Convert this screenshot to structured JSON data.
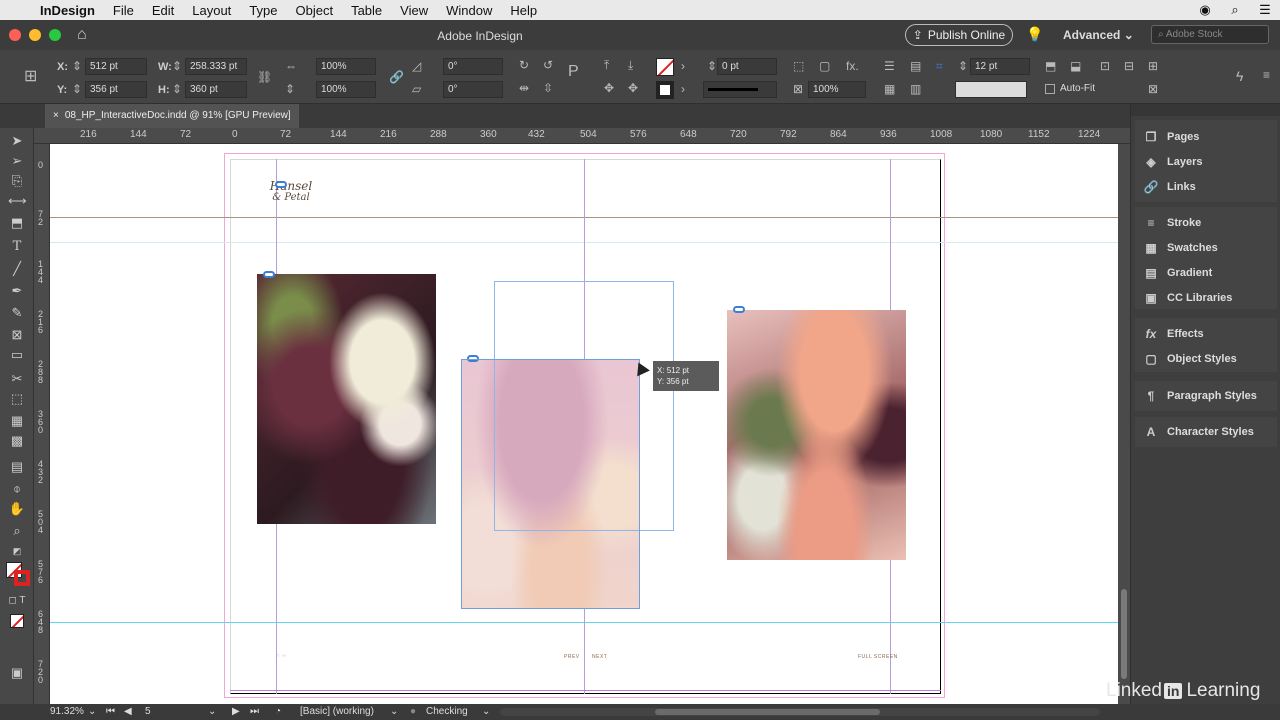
{
  "menubar": {
    "app": "InDesign",
    "items": [
      "File",
      "Edit",
      "Layout",
      "Type",
      "Object",
      "Table",
      "View",
      "Window",
      "Help"
    ]
  },
  "appbar": {
    "title": "Adobe InDesign",
    "publish": "Publish Online",
    "workspace": "Advanced",
    "stock_placeholder": "Adobe Stock"
  },
  "control": {
    "x_label": "X:",
    "x": "512 pt",
    "y_label": "Y:",
    "y": "356 pt",
    "w_label": "W:",
    "w": "258.333 pt",
    "h_label": "H:",
    "h": "360 pt",
    "scale_x": "100%",
    "scale_y": "100%",
    "rotate": "0°",
    "shear": "0°",
    "stroke_weight": "0 pt",
    "opacity": "100%",
    "gutter": "12 pt",
    "autofit": "Auto-Fit"
  },
  "doc": {
    "tab": "08_HP_InteractiveDoc.indd @ 91% [GPU Preview]"
  },
  "ruler_h": [
    "216",
    "144",
    "72",
    "0",
    "72",
    "144",
    "216",
    "288",
    "360",
    "432",
    "504",
    "576",
    "648",
    "720",
    "792",
    "864",
    "936",
    "1008",
    "1080",
    "1152",
    "1224"
  ],
  "ruler_v": [
    "0",
    "7 2",
    "1 4 4",
    "2 1 6",
    "2 8 8",
    "3 6 0",
    "4 3 2",
    "5 0 4",
    "5 7 6",
    "6 4 8",
    "7 2 0"
  ],
  "canvas": {
    "logo_line1": "Hansel",
    "logo_line2": "& Petal",
    "tooltip_x": "X: 512 pt",
    "tooltip_y": "Y: 356 pt",
    "footer_prev": "PREV",
    "footer_next": "NEXT",
    "footer_full": "FULL SCREEN"
  },
  "panels": {
    "group1": [
      "Pages",
      "Layers",
      "Links"
    ],
    "group2": [
      "Stroke",
      "Swatches",
      "Gradient",
      "CC Libraries"
    ],
    "group3": [
      "Effects",
      "Object Styles"
    ],
    "group4": [
      "Paragraph Styles"
    ],
    "group5": [
      "Character Styles"
    ]
  },
  "status": {
    "zoom": "91.32%",
    "page": "5",
    "style": "[Basic] (working)",
    "preflight": "Checking"
  },
  "watermark": {
    "left": "Linked",
    "in": "in",
    "right": "Learning"
  },
  "colors": {
    "accent": "#3a7fd5",
    "traffic_red": "#fe5f57",
    "traffic_yellow": "#febc2e",
    "traffic_green": "#28c840"
  }
}
